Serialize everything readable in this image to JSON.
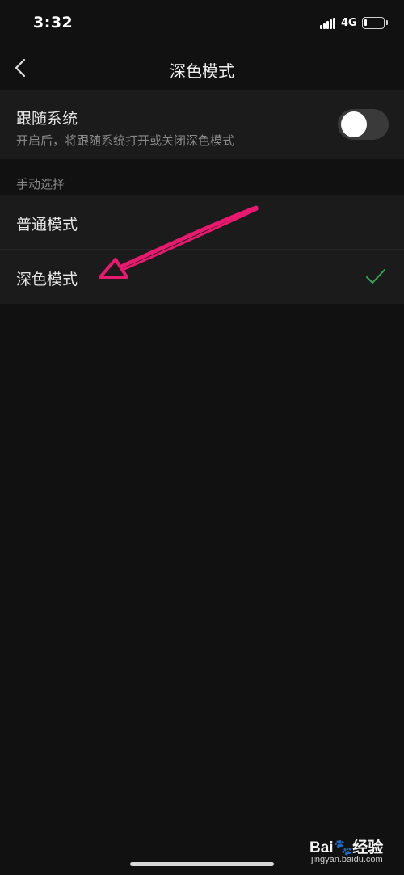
{
  "status_bar": {
    "time": "3:32",
    "network": "4G",
    "battery_level": 0.15
  },
  "nav": {
    "title": "深色模式",
    "back_icon": "chevron-left-icon"
  },
  "follow_system": {
    "title": "跟随系统",
    "description": "开启后，将跟随系统打开或关闭深色模式",
    "enabled": false
  },
  "manual": {
    "header": "手动选择",
    "options": [
      {
        "label": "普通模式",
        "selected": false
      },
      {
        "label": "深色模式",
        "selected": true
      }
    ],
    "check_color": "#2eaa5a"
  },
  "annotation": {
    "arrow_color": "#e8196e"
  },
  "watermark": {
    "brand": "Baidu经验",
    "url": "jingyan.baidu.com"
  }
}
